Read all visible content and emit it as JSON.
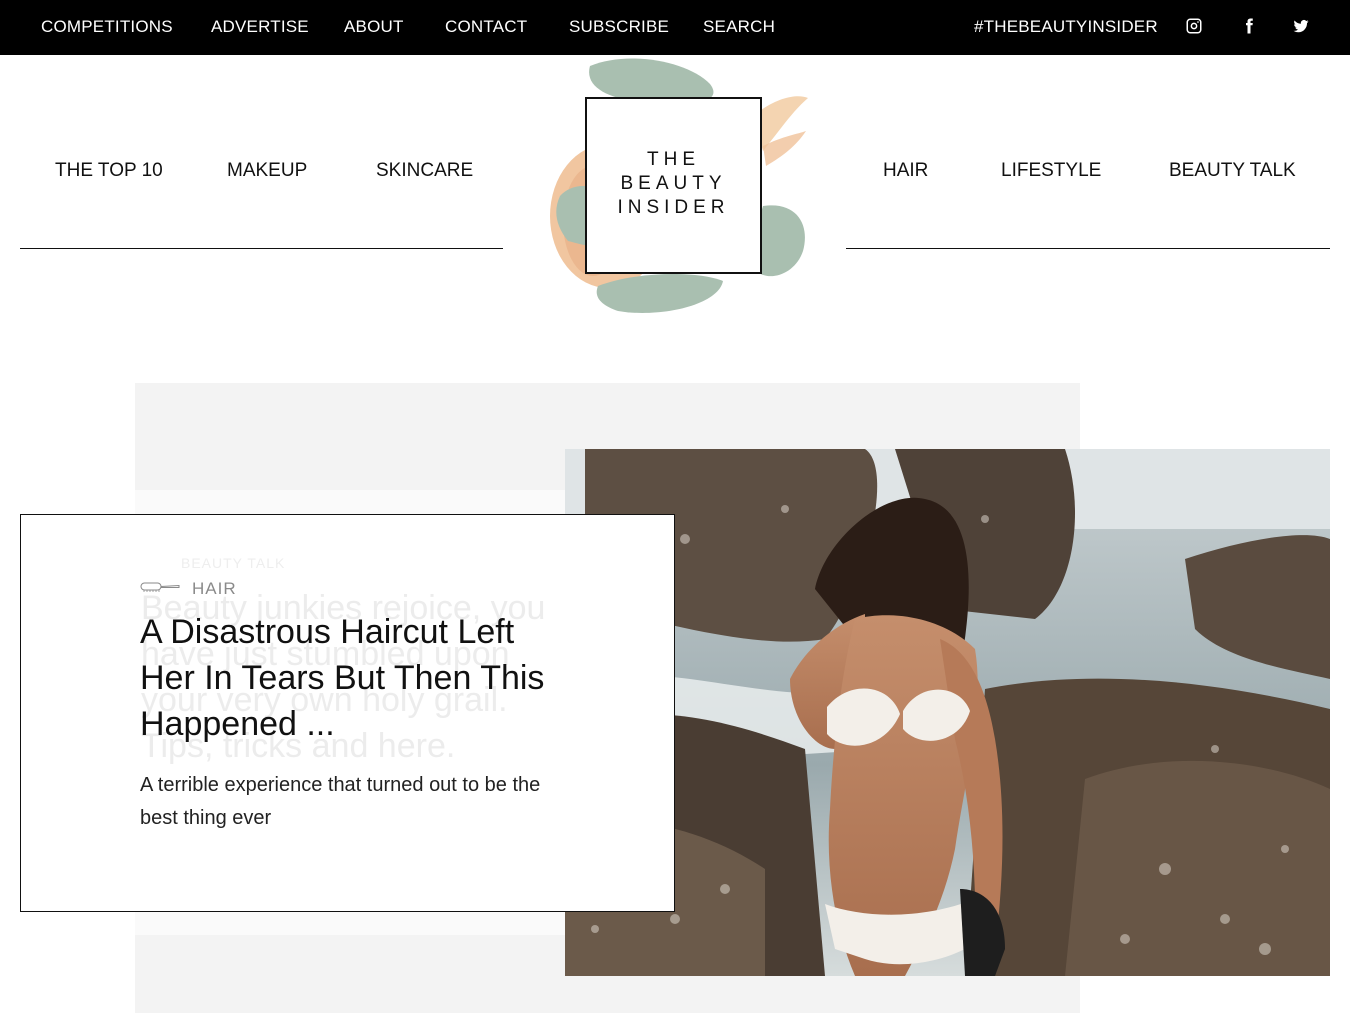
{
  "topbar": {
    "links": [
      "COMPETITIONS",
      "ADVERTISE",
      "ABOUT",
      "CONTACT",
      "SUBSCRIBE",
      "SEARCH"
    ],
    "hashtag": "#THEBEAUTYINSIDER",
    "social_icons": [
      "instagram-icon",
      "facebook-icon",
      "twitter-icon"
    ]
  },
  "nav": {
    "left": [
      "THE TOP 10",
      "MAKEUP",
      "SKINCARE"
    ],
    "right": [
      "HAIR",
      "LIFESTYLE",
      "BEAUTY TALK"
    ]
  },
  "logo": {
    "line1": "THE",
    "line2": "BEAUTY",
    "line3": "INSIDER",
    "colors": {
      "sage": "#a9bfb0",
      "peach": "#f0c29a"
    }
  },
  "feature": {
    "category": "HAIR",
    "category_icon": "hairbrush-icon",
    "headline": "A Disastrous Haircut Left Her In Tears But Then This Happened ...",
    "dek": "A terrible experience that turned out to be the best thing ever",
    "ghost_category": "BEAUTY TALK",
    "ghost_text": "Beauty junkies rejoice, you have just stumbled upon your very own holy grail. Tips, tricks and here."
  }
}
